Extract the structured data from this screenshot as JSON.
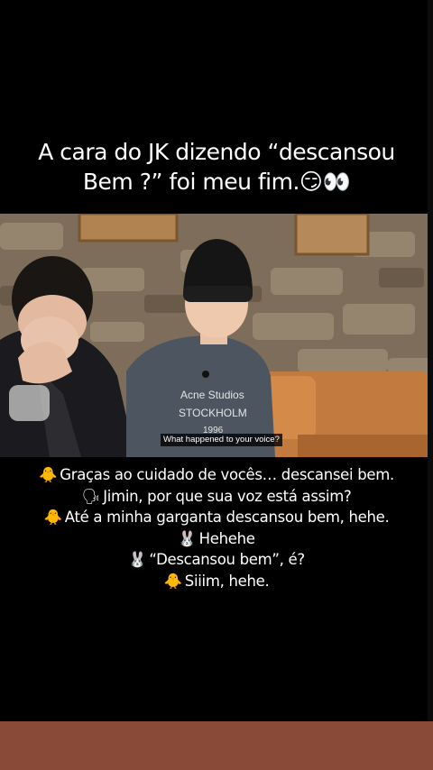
{
  "story": {
    "caption": {
      "line1": "A cara do JK dizendo “descansou",
      "line2": "Bem ?” foi meu fim.",
      "emojis": "😏👀"
    },
    "video": {
      "subtitle": "What happened to your voice?",
      "shirt_text_line1": "Acne Studios",
      "shirt_text_line2": "STOCKHOLM",
      "shirt_text_line3": "1996"
    },
    "dialogue": [
      {
        "icon": "🐥",
        "icon_name": "chick-icon",
        "text": "Graças ao cuidado de vocês… descansei bem."
      },
      {
        "icon": "🗣",
        "icon_name": "speaking-head-icon",
        "text": "Jimin, por que sua voz está assim?"
      },
      {
        "icon": "🐥",
        "icon_name": "chick-icon",
        "text": "Até a minha garganta descansou bem, hehe."
      },
      {
        "icon": "🐰",
        "icon_name": "bunny-icon",
        "text": "Hehehe"
      },
      {
        "icon": "🐰",
        "icon_name": "bunny-icon",
        "text": "“Descansou bem”, é?"
      },
      {
        "icon": "🐥",
        "icon_name": "chick-icon",
        "text": "Siiim, hehe."
      }
    ],
    "colors": {
      "background": "#000000",
      "bottom_bar": "#8a4a38",
      "text": "#ffffff"
    }
  }
}
